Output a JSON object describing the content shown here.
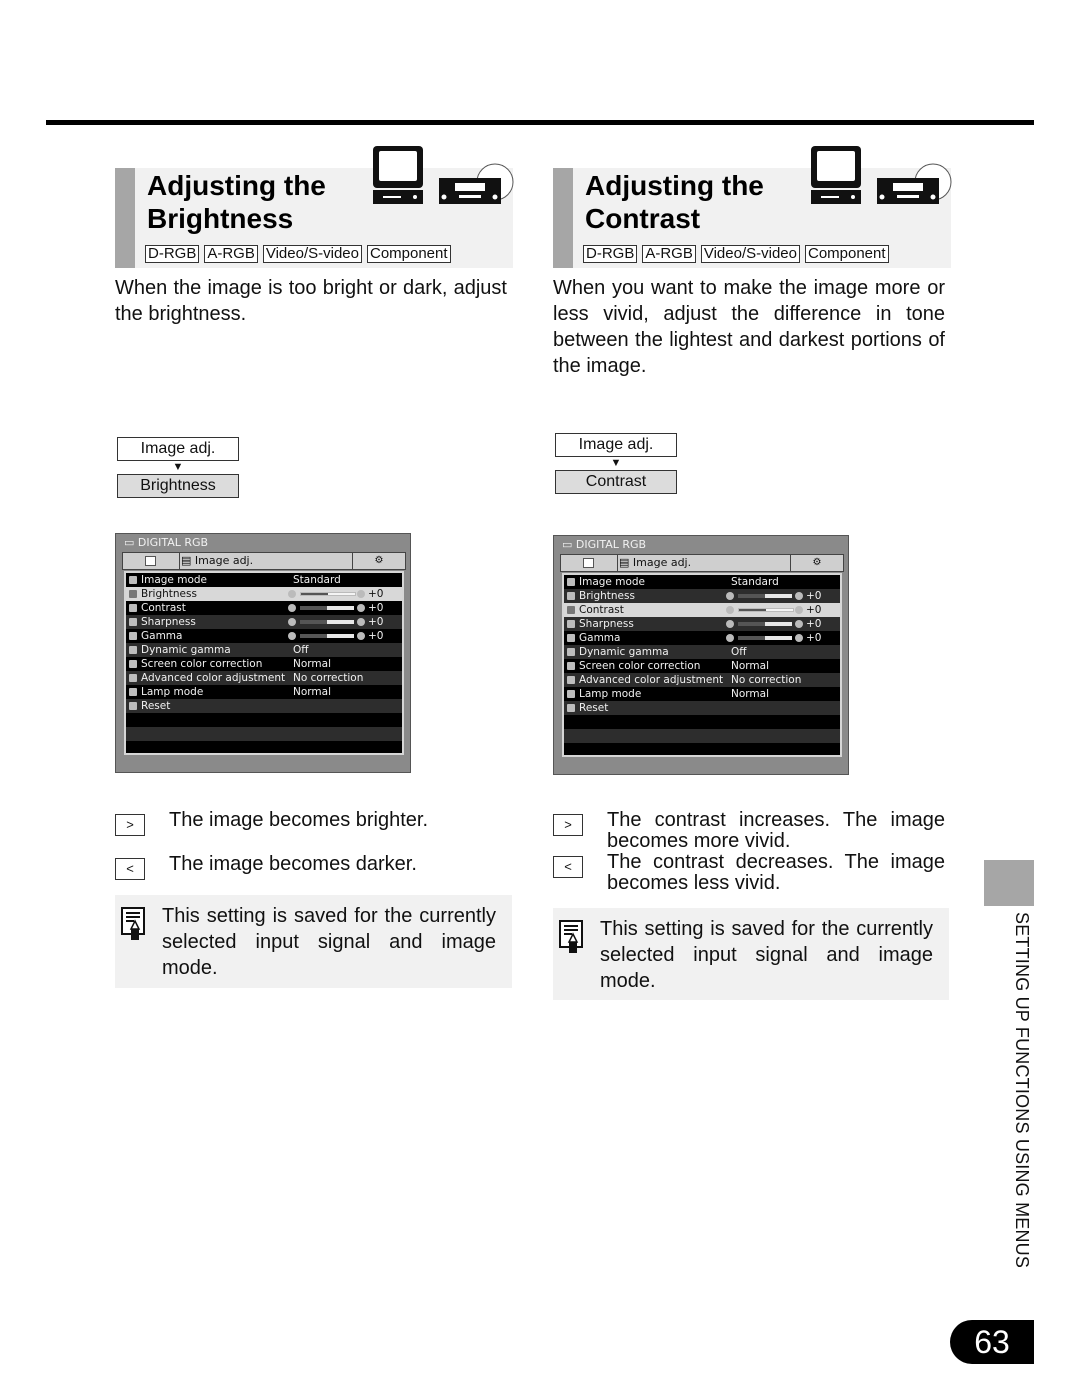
{
  "page": {
    "side_label": "SETTING UP FUNCTIONS USING MENUS",
    "page_number": "63"
  },
  "sections": [
    {
      "title_line1": "Adjusting the",
      "title_line2": "Brightness",
      "icons": [
        "computer-monitor-icon",
        "video-player-disc-icon"
      ],
      "tags": [
        "D-RGB",
        "A-RGB",
        "Video/S-video",
        "Component"
      ],
      "intro": "When the image is too bright or dark, adjust the brightness.",
      "flow": {
        "parent": "Image adj.",
        "arrow": "▼",
        "child": "Brightness"
      },
      "osd": {
        "source": "DIGITAL RGB",
        "tab_label": "Image adj.",
        "selected_row": 1,
        "rows": [
          {
            "label": "Image mode",
            "value": "Standard",
            "icon": "image-mode-icon"
          },
          {
            "label": "Brightness",
            "slider": "+0",
            "level": 0.5,
            "icon": "brightness-icon"
          },
          {
            "label": "Contrast",
            "slider": "+0",
            "level": 0.5,
            "icon": "contrast-icon"
          },
          {
            "label": "Sharpness",
            "slider": "+0",
            "level": 0.5,
            "icon": "sharpness-icon"
          },
          {
            "label": "Gamma",
            "slider": "+0",
            "level": 0.5,
            "icon": "gamma-icon"
          },
          {
            "label": "Dynamic gamma",
            "value": "Off",
            "icon": "dynamic-gamma-icon"
          },
          {
            "label": "Screen color correction",
            "value": "Normal",
            "icon": "screen-color-icon"
          },
          {
            "label": "Advanced color adjustment",
            "value": "No correction",
            "icon": "color-adjust-icon"
          },
          {
            "label": "Lamp mode",
            "value": "Normal",
            "icon": "lamp-icon"
          },
          {
            "label": "Reset",
            "value": "",
            "icon": "reset-icon"
          },
          {
            "label": "",
            "value": ""
          },
          {
            "label": "",
            "value": ""
          },
          {
            "label": "",
            "value": ""
          }
        ]
      },
      "ops": [
        {
          "key": ">",
          "text": "The image becomes brighter."
        },
        {
          "key": "<",
          "text": "The image becomes darker."
        }
      ],
      "note": "This setting is saved for the currently selected input signal and image mode."
    },
    {
      "title_line1": "Adjusting the",
      "title_line2": "Contrast",
      "icons": [
        "computer-monitor-icon",
        "video-player-disc-icon"
      ],
      "tags": [
        "D-RGB",
        "A-RGB",
        "Video/S-video",
        "Component"
      ],
      "intro": "When you want to make the image more or less vivid, adjust the difference in tone between the lightest and darkest portions of the image.",
      "flow": {
        "parent": "Image adj.",
        "arrow": "▼",
        "child": "Contrast"
      },
      "osd": {
        "source": "DIGITAL RGB",
        "tab_label": "Image adj.",
        "selected_row": 2,
        "rows": [
          {
            "label": "Image mode",
            "value": "Standard",
            "icon": "image-mode-icon"
          },
          {
            "label": "Brightness",
            "slider": "+0",
            "level": 0.5,
            "icon": "brightness-icon"
          },
          {
            "label": "Contrast",
            "slider": "+0",
            "level": 0.5,
            "icon": "contrast-icon"
          },
          {
            "label": "Sharpness",
            "slider": "+0",
            "level": 0.5,
            "icon": "sharpness-icon"
          },
          {
            "label": "Gamma",
            "slider": "+0",
            "level": 0.5,
            "icon": "gamma-icon"
          },
          {
            "label": "Dynamic gamma",
            "value": "Off",
            "icon": "dynamic-gamma-icon"
          },
          {
            "label": "Screen color correction",
            "value": "Normal",
            "icon": "screen-color-icon"
          },
          {
            "label": "Advanced color adjustment",
            "value": "No correction",
            "icon": "color-adjust-icon"
          },
          {
            "label": "Lamp mode",
            "value": "Normal",
            "icon": "lamp-icon"
          },
          {
            "label": "Reset",
            "value": "",
            "icon": "reset-icon"
          },
          {
            "label": "",
            "value": ""
          },
          {
            "label": "",
            "value": ""
          },
          {
            "label": "",
            "value": ""
          }
        ]
      },
      "ops": [
        {
          "key": ">",
          "text": "The contrast increases. The image becomes more vivid."
        },
        {
          "key": "<",
          "text": "The contrast decreases. The image becomes less vivid."
        }
      ],
      "note": "This setting is saved for the currently selected input signal and image mode."
    }
  ]
}
